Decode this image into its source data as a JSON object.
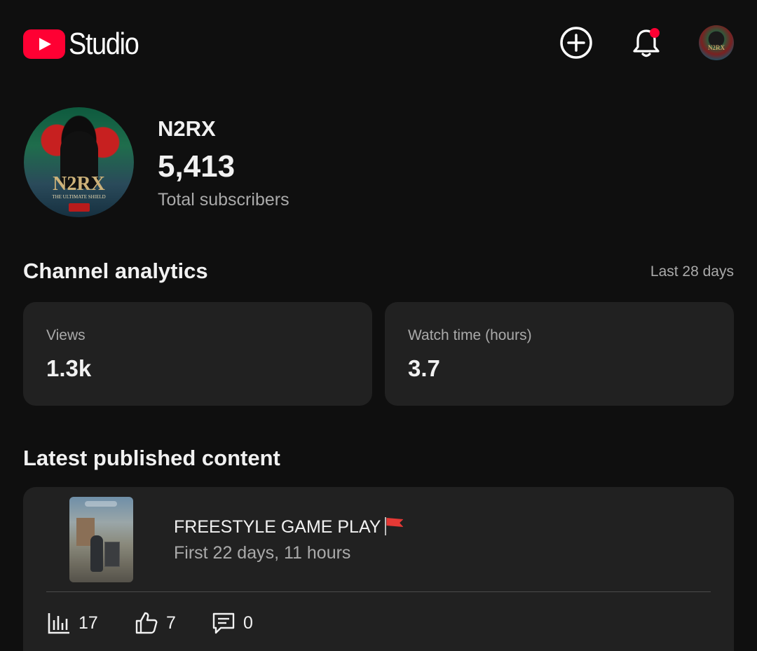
{
  "app": {
    "logo_text": "Studio",
    "brand_color": "#ff0033"
  },
  "header": {
    "create_icon": "create-plus-icon",
    "notifications_icon": "bell-icon",
    "notification_dot_color": "#ff0033",
    "account_icon": "account-avatar"
  },
  "channel": {
    "name": "N2RX",
    "subscribers": "5,413",
    "subscribers_label": "Total subscribers",
    "avatar_text": "N2RX",
    "avatar_subtext": "THE ULTIMATE SHIELD"
  },
  "analytics": {
    "title": "Channel analytics",
    "period": "Last 28 days",
    "cards": [
      {
        "label": "Views",
        "value": "1.3k"
      },
      {
        "label": "Watch time (hours)",
        "value": "3.7"
      }
    ]
  },
  "latest": {
    "title": "Latest published content",
    "video": {
      "title": "FREESTYLE GAME PLAY",
      "title_emoji": "red-flag",
      "meta": "First 22 days, 11 hours",
      "stats": {
        "views": "17",
        "likes": "7",
        "comments": "0"
      }
    }
  }
}
